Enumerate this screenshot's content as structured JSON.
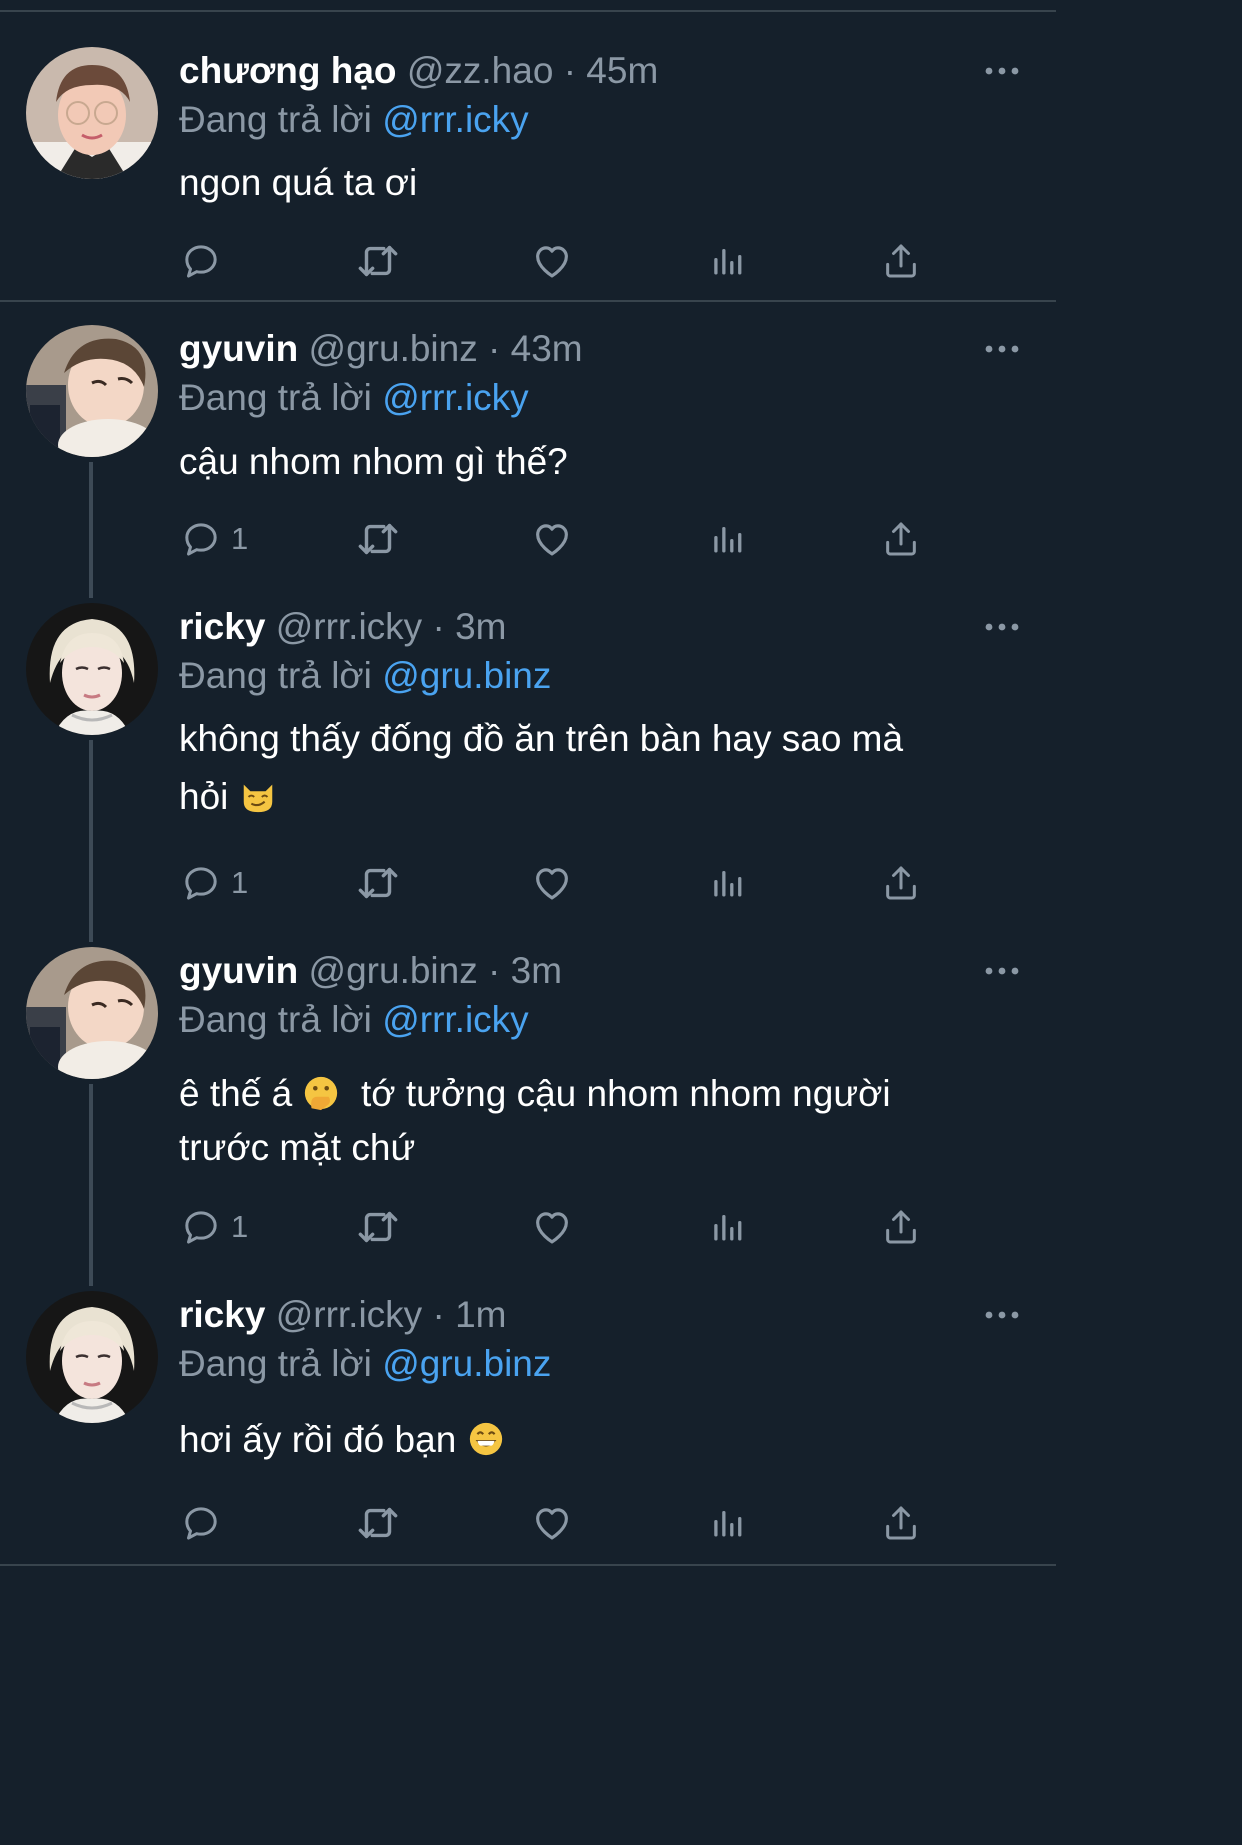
{
  "reply_prefix": "Đang trả lời",
  "tweets": [
    {
      "name": "chương hạo",
      "handle": "@zz.hao",
      "time": "45m",
      "reply_to": "@rrr.icky",
      "text": "ngon quá ta ơi",
      "reply_count": "",
      "avatar": "chuong-hao-avatar"
    },
    {
      "name": "gyuvin",
      "handle": "@gru.binz",
      "time": "43m",
      "reply_to": "@rrr.icky",
      "text": "cậu nhom nhom gì thế?",
      "reply_count": "1",
      "avatar": "gyuvin-avatar"
    },
    {
      "name": "ricky",
      "handle": "@rrr.icky",
      "time": "3m",
      "reply_to": "@gru.binz",
      "text_line1": "không thấy đống đồ ăn trên bàn hay sao mà",
      "text_line2": "hỏi",
      "emoji": "smirking-cat-emoji",
      "reply_count": "1",
      "avatar": "ricky-avatar"
    },
    {
      "name": "gyuvin",
      "handle": "@gru.binz",
      "time": "3m",
      "reply_to": "@rrr.icky",
      "text_part1": "ê thế á",
      "emoji": "face-with-hand-over-mouth-emoji",
      "text_part2": "tớ tưởng cậu nhom nhom người",
      "text_line2": "trước mặt chứ",
      "reply_count": "1",
      "avatar": "gyuvin-avatar"
    },
    {
      "name": "ricky",
      "handle": "@rrr.icky",
      "time": "1m",
      "reply_to": "@gru.binz",
      "text": "hơi ấy rồi đó bạn",
      "emoji": "grinning-face-emoji",
      "reply_count": "",
      "avatar": "ricky-avatar"
    }
  ],
  "actions": [
    "reply-icon",
    "retweet-icon",
    "like-icon",
    "views-icon",
    "share-icon"
  ],
  "colors": {
    "background": "#15202b",
    "divider": "#38444d",
    "secondary_text": "#8b98a5",
    "mention": "#4aa3f0"
  }
}
